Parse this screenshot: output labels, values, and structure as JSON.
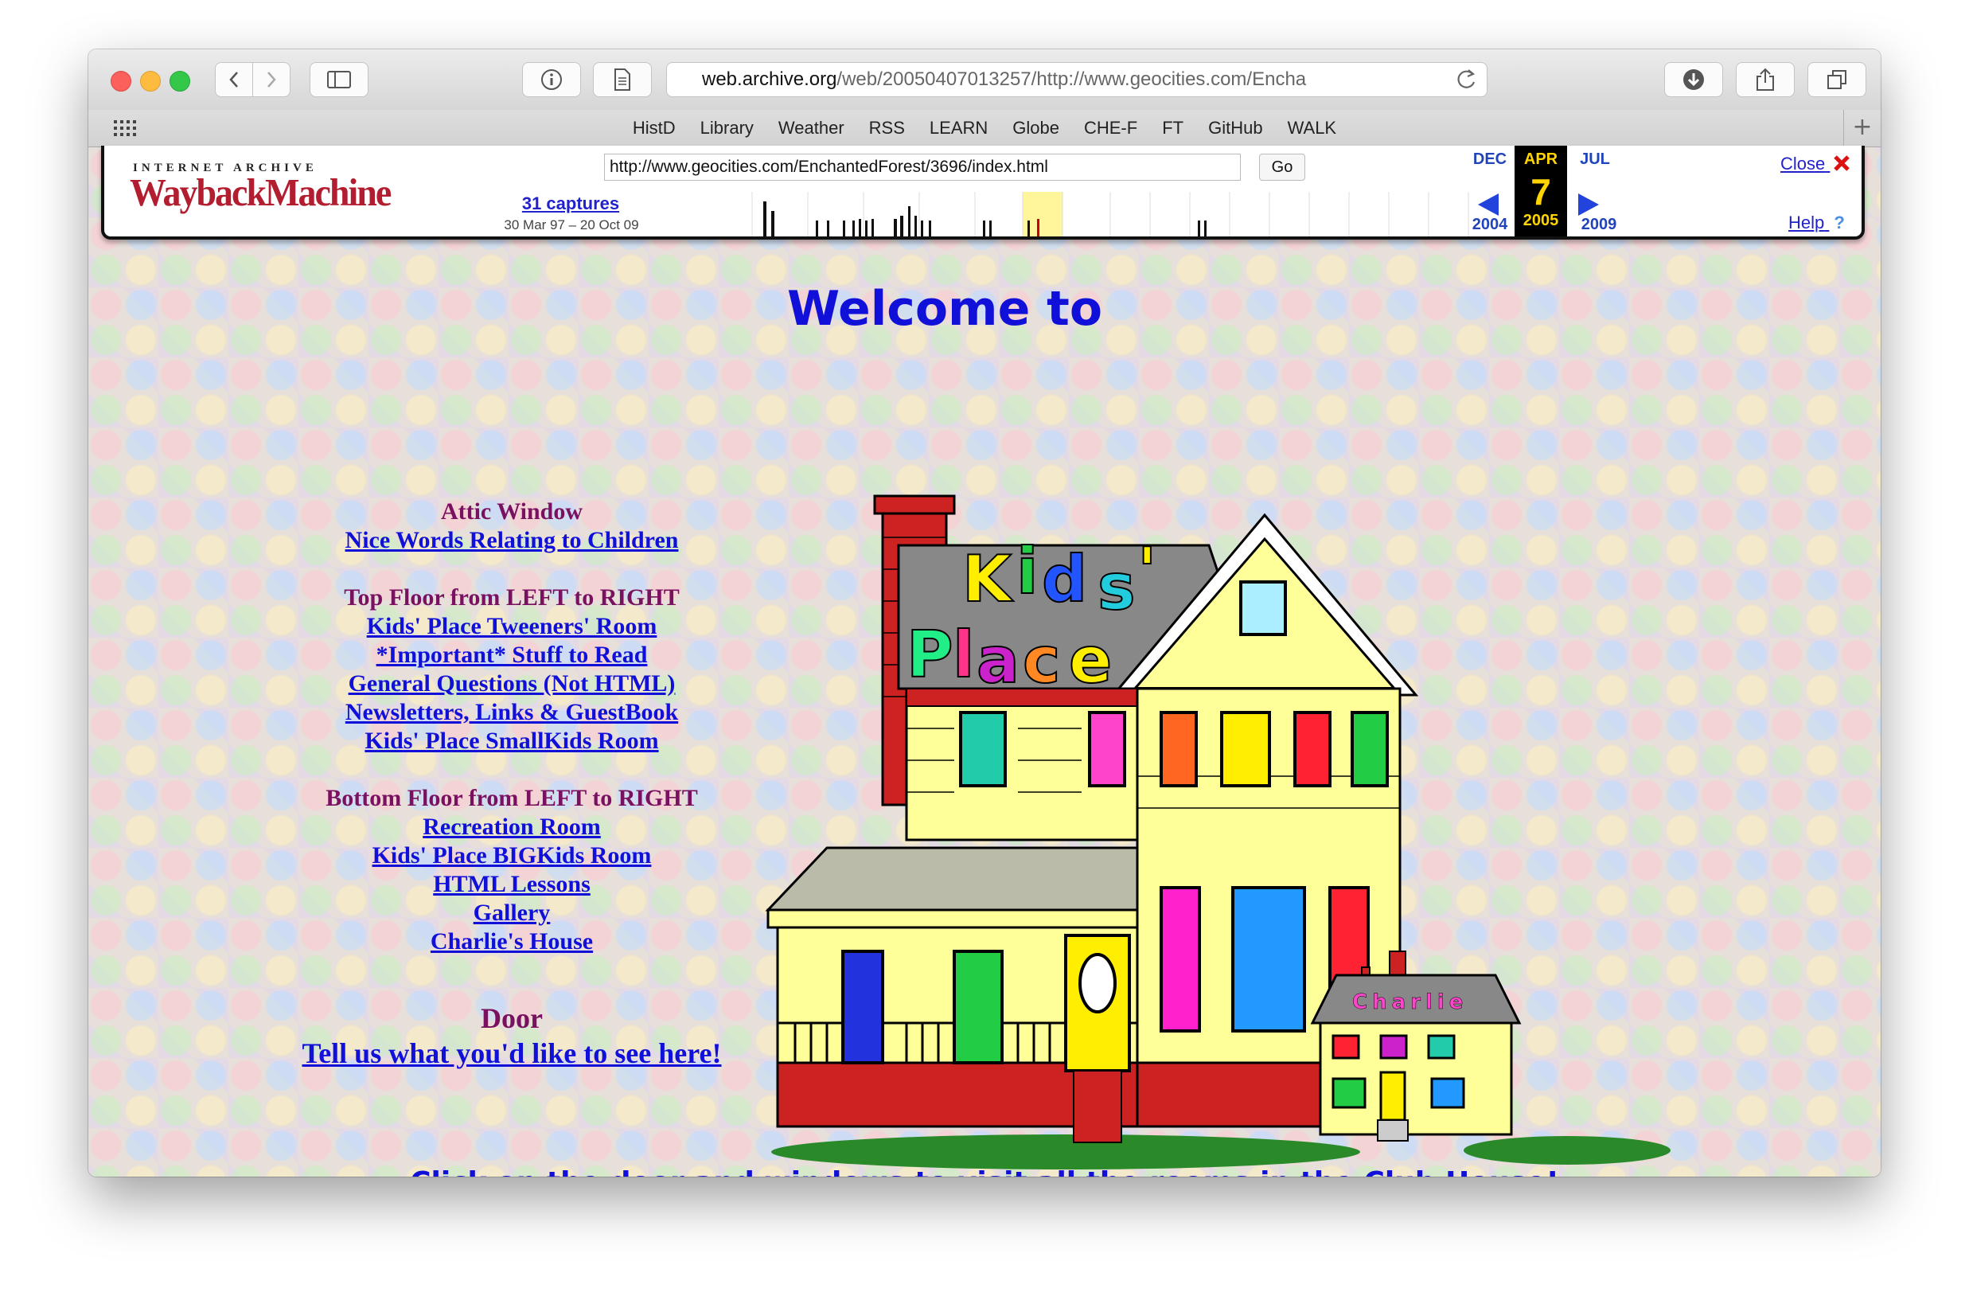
{
  "browser": {
    "address_host": "web.archive.org",
    "address_rest": "/web/20050407013257/http://www.geocities.com/Encha",
    "bookmarks": [
      "HistD",
      "Library",
      "Weather",
      "RSS",
      "LEARN",
      "Globe",
      "CHE-F",
      "FT",
      "GitHub",
      "WALK"
    ]
  },
  "wayback": {
    "logo_top": "INTERNET ARCHIVE",
    "logo_main": "WaybackMachine",
    "url_value": "http://www.geocities.com/EnchantedForest/3696/index.html",
    "go_label": "Go",
    "captures": "31 captures",
    "range": "30 Mar 97 – 20 Oct 09",
    "prev_month": "DEC",
    "prev_year": "2004",
    "cur_month": "APR",
    "cur_day": "7",
    "cur_year": "2005",
    "next_month": "JUL",
    "next_year": "2009",
    "close_label": "Close",
    "help_label": "Help"
  },
  "page": {
    "welcome": "Welcome to",
    "attic_header": "Attic Window",
    "attic_links": [
      "Nice Words Relating to Children "
    ],
    "top_header": "Top Floor from LEFT to RIGHT",
    "top_links": [
      "Kids' Place Tweeners' Room ",
      "*Important* Stuff to Read",
      "General Questions (Not HTML)",
      "Newsletters, Links & GuestBook",
      "Kids' Place SmallKids Room"
    ],
    "bottom_header": "Bottom Floor from LEFT to RIGHT",
    "bottom_links": [
      "Recreation Room",
      "Kids' Place BIGKids Room",
      "HTML Lessons",
      "Gallery ",
      "Charlie's House"
    ],
    "door_header": "Door",
    "door_link": "Tell us what you'd like to see here!",
    "house_sign": [
      "K",
      "i",
      "d",
      "s",
      "'"
    ],
    "house_sign2": [
      "P",
      "l",
      "a",
      "c",
      "e"
    ],
    "charlie_sign": "Charlie",
    "bottom_message": "Click on the door and windows to visit all the rooms in the Club House!"
  }
}
